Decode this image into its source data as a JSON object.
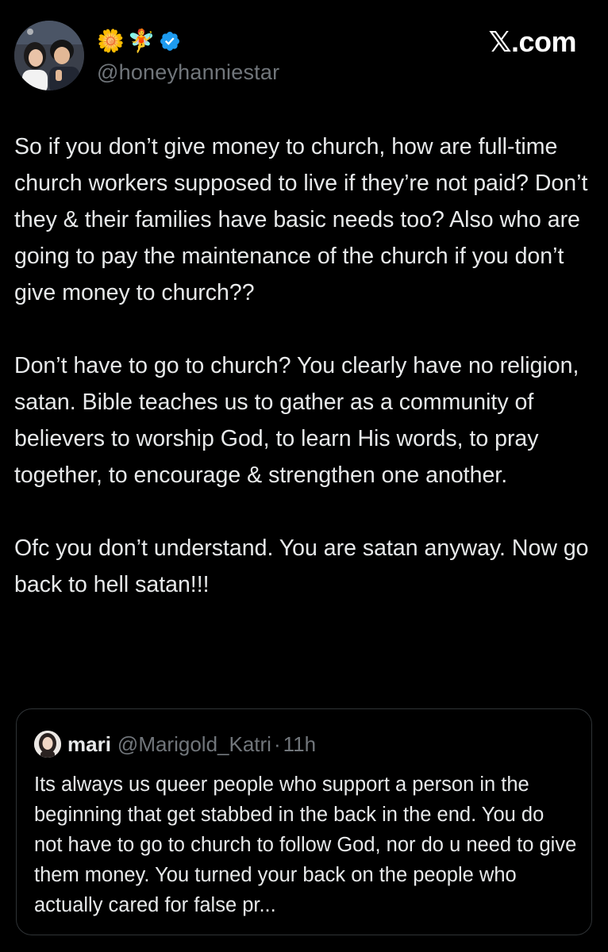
{
  "site": {
    "label": "𝕏.com"
  },
  "author": {
    "avatar_icon": "profile-photo-two-people",
    "emojis": [
      "🌼",
      "🧚"
    ],
    "verified_icon": "verified-badge-icon",
    "handle": "@honeyhanniestar"
  },
  "tweet": {
    "paragraphs": [
      "So if you don’t give money to church, how are full-time church workers supposed to live if they’re not paid? Don’t they & their families have basic needs too? Also who are going to pay the maintenance of the church if you don’t give money to church??",
      "Don’t have to go to church? You clearly have no religion, satan. Bible teaches us to gather as a community of believers to worship God, to learn His words, to pray together, to encourage & strengthen one another.",
      "Ofc you don’t understand. You are satan anyway. Now go back to hell satan!!!"
    ]
  },
  "quote": {
    "avatar_icon": "quoted-user-avatar",
    "name": "mari",
    "handle": "@Marigold_Katri",
    "separator": "·",
    "time": "11h",
    "text": "Its always us queer people who support a person in the beginning that get stabbed in the back in the end. You do not have to go to church to follow God, nor do u need to give them money. You turned your back on the people who actually cared for false pr..."
  },
  "colors": {
    "background": "#000000",
    "text": "#e7e9ea",
    "muted": "#71767b",
    "border": "#2f3336",
    "verified": "#1d9bf0"
  }
}
